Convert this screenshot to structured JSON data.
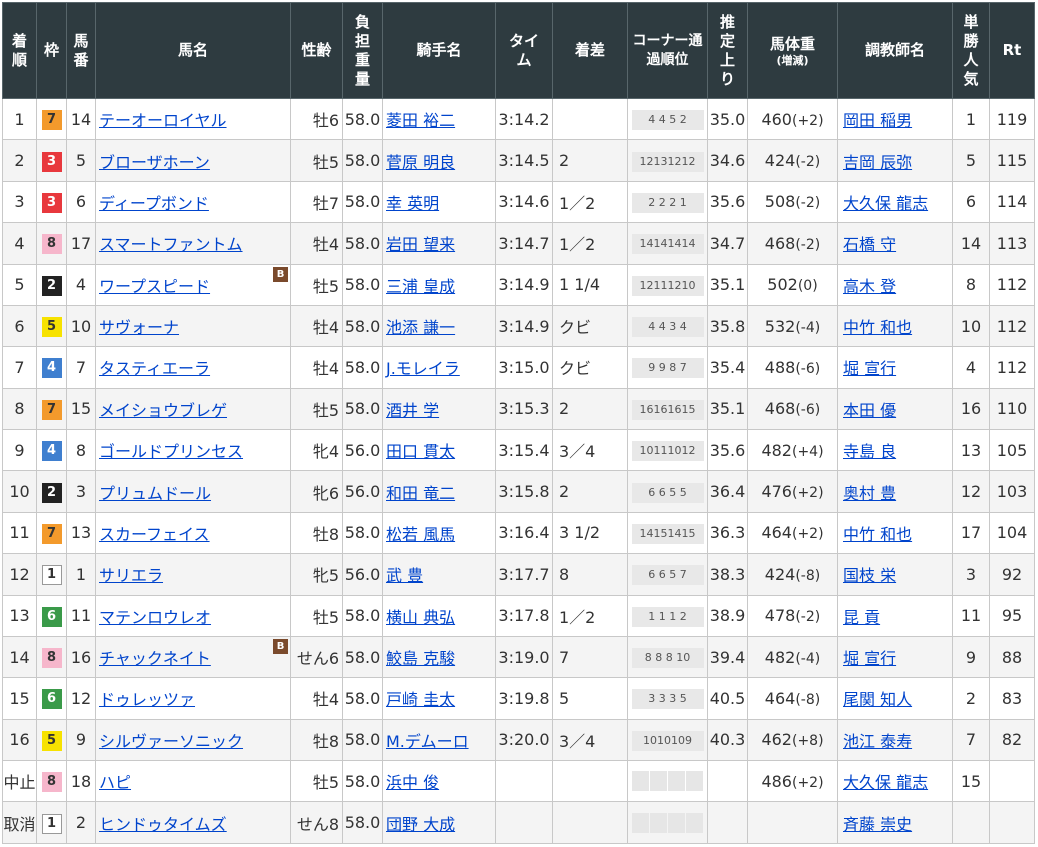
{
  "headers": {
    "rank": "着順",
    "waku": "枠",
    "umaban": "馬番",
    "horse": "馬名",
    "sex_age": "性齢",
    "weight": "負担重量",
    "jockey": "騎手名",
    "time": "タイム",
    "margin": "着差",
    "corner": "コーナー通過順位",
    "last3f": "推定上り",
    "body_weight": "馬体重",
    "body_weight_sub": "(増減)",
    "trainer": "調教師名",
    "popularity": "単勝人気",
    "rt": "Rt"
  },
  "blinker_label": "B",
  "rows": [
    {
      "rank": "1",
      "waku": "7",
      "num": "14",
      "horse": "テーオーロイヤル",
      "blinker": false,
      "sexage": "牡6",
      "wt": "58.0",
      "jockey": "菱田 裕二",
      "time": "3:14.2",
      "margin": "",
      "corner": "4 4 5 2",
      "last3f": "35.0",
      "bw": "460",
      "bwd": "(+2)",
      "trainer": "岡田 稲男",
      "pop": "1",
      "rt": "119"
    },
    {
      "rank": "2",
      "waku": "3",
      "num": "5",
      "horse": "ブローザホーン",
      "blinker": false,
      "sexage": "牡5",
      "wt": "58.0",
      "jockey": "菅原 明良",
      "time": "3:14.5",
      "margin": "2",
      "corner": "12131212",
      "last3f": "34.6",
      "bw": "424",
      "bwd": "(-2)",
      "trainer": "吉岡 辰弥",
      "pop": "5",
      "rt": "115"
    },
    {
      "rank": "3",
      "waku": "3",
      "num": "6",
      "horse": "ディープボンド",
      "blinker": false,
      "sexage": "牡7",
      "wt": "58.0",
      "jockey": "幸 英明",
      "time": "3:14.6",
      "margin": "1／2",
      "corner": "2 2 2 1",
      "last3f": "35.6",
      "bw": "508",
      "bwd": "(-2)",
      "trainer": "大久保 龍志",
      "pop": "6",
      "rt": "114"
    },
    {
      "rank": "4",
      "waku": "8",
      "num": "17",
      "horse": "スマートファントム",
      "blinker": false,
      "sexage": "牡4",
      "wt": "58.0",
      "jockey": "岩田 望来",
      "time": "3:14.7",
      "margin": "1／2",
      "corner": "14141414",
      "last3f": "34.7",
      "bw": "468",
      "bwd": "(-2)",
      "trainer": "石橋 守",
      "pop": "14",
      "rt": "113"
    },
    {
      "rank": "5",
      "waku": "2",
      "num": "4",
      "horse": "ワープスピード",
      "blinker": true,
      "sexage": "牡5",
      "wt": "58.0",
      "jockey": "三浦 皇成",
      "time": "3:14.9",
      "margin": "1 1/4",
      "corner": "12111210",
      "last3f": "35.1",
      "bw": "502",
      "bwd": "(0)",
      "trainer": "高木 登",
      "pop": "8",
      "rt": "112"
    },
    {
      "rank": "6",
      "waku": "5",
      "num": "10",
      "horse": "サヴォーナ",
      "blinker": false,
      "sexage": "牡4",
      "wt": "58.0",
      "jockey": "池添 謙一",
      "time": "3:14.9",
      "margin": "クビ",
      "corner": "4 4 3 4",
      "last3f": "35.8",
      "bw": "532",
      "bwd": "(-4)",
      "trainer": "中竹 和也",
      "pop": "10",
      "rt": "112"
    },
    {
      "rank": "7",
      "waku": "4",
      "num": "7",
      "horse": "タスティエーラ",
      "blinker": false,
      "sexage": "牡4",
      "wt": "58.0",
      "jockey": "J.モレイラ",
      "time": "3:15.0",
      "margin": "クビ",
      "corner": "9 9 8 7",
      "last3f": "35.4",
      "bw": "488",
      "bwd": "(-6)",
      "trainer": "堀 宣行",
      "pop": "4",
      "rt": "112"
    },
    {
      "rank": "8",
      "waku": "7",
      "num": "15",
      "horse": "メイショウブレゲ",
      "blinker": false,
      "sexage": "牡5",
      "wt": "58.0",
      "jockey": "酒井 学",
      "time": "3:15.3",
      "margin": "2",
      "corner": "16161615",
      "last3f": "35.1",
      "bw": "468",
      "bwd": "(-6)",
      "trainer": "本田 優",
      "pop": "16",
      "rt": "110"
    },
    {
      "rank": "9",
      "waku": "4",
      "num": "8",
      "horse": "ゴールドプリンセス",
      "blinker": false,
      "sexage": "牝4",
      "wt": "56.0",
      "jockey": "田口 貫太",
      "time": "3:15.4",
      "margin": "3／4",
      "corner": "10111012",
      "last3f": "35.6",
      "bw": "482",
      "bwd": "(+4)",
      "trainer": "寺島 良",
      "pop": "13",
      "rt": "105"
    },
    {
      "rank": "10",
      "waku": "2",
      "num": "3",
      "horse": "プリュムドール",
      "blinker": false,
      "sexage": "牝6",
      "wt": "56.0",
      "jockey": "和田 竜二",
      "time": "3:15.8",
      "margin": "2",
      "corner": "6 6 5 5",
      "last3f": "36.4",
      "bw": "476",
      "bwd": "(+2)",
      "trainer": "奥村 豊",
      "pop": "12",
      "rt": "103"
    },
    {
      "rank": "11",
      "waku": "7",
      "num": "13",
      "horse": "スカーフェイス",
      "blinker": false,
      "sexage": "牡8",
      "wt": "58.0",
      "jockey": "松若 風馬",
      "time": "3:16.4",
      "margin": "3 1/2",
      "corner": "14151415",
      "last3f": "36.3",
      "bw": "464",
      "bwd": "(+2)",
      "trainer": "中竹 和也",
      "pop": "17",
      "rt": "104"
    },
    {
      "rank": "12",
      "waku": "1",
      "num": "1",
      "horse": "サリエラ",
      "blinker": false,
      "sexage": "牝5",
      "wt": "56.0",
      "jockey": "武 豊",
      "time": "3:17.7",
      "margin": "8",
      "corner": "6 6 5 7",
      "last3f": "38.3",
      "bw": "424",
      "bwd": "(-8)",
      "trainer": "国枝 栄",
      "pop": "3",
      "rt": "92"
    },
    {
      "rank": "13",
      "waku": "6",
      "num": "11",
      "horse": "マテンロウレオ",
      "blinker": false,
      "sexage": "牡5",
      "wt": "58.0",
      "jockey": "横山 典弘",
      "time": "3:17.8",
      "margin": "1／2",
      "corner": "1 1 1 2",
      "last3f": "38.9",
      "bw": "478",
      "bwd": "(-2)",
      "trainer": "昆 貢",
      "pop": "11",
      "rt": "95"
    },
    {
      "rank": "14",
      "waku": "8",
      "num": "16",
      "horse": "チャックネイト",
      "blinker": true,
      "sexage": "せん6",
      "wt": "58.0",
      "jockey": "鮫島 克駿",
      "time": "3:19.0",
      "margin": "7",
      "corner": "8 8 8 10",
      "last3f": "39.4",
      "bw": "482",
      "bwd": "(-4)",
      "trainer": "堀 宣行",
      "pop": "9",
      "rt": "88"
    },
    {
      "rank": "15",
      "waku": "6",
      "num": "12",
      "horse": "ドゥレッツァ",
      "blinker": false,
      "sexage": "牡4",
      "wt": "58.0",
      "jockey": "戸崎 圭太",
      "time": "3:19.8",
      "margin": "5",
      "corner": "3 3 3 5",
      "last3f": "40.5",
      "bw": "464",
      "bwd": "(-8)",
      "trainer": "尾関 知人",
      "pop": "2",
      "rt": "83"
    },
    {
      "rank": "16",
      "waku": "5",
      "num": "9",
      "horse": "シルヴァーソニック",
      "blinker": false,
      "sexage": "牡8",
      "wt": "58.0",
      "jockey": "M.デムーロ",
      "time": "3:20.0",
      "margin": "3／4",
      "corner": "1010109",
      "last3f": "40.3",
      "bw": "462",
      "bwd": "(+8)",
      "trainer": "池江 泰寿",
      "pop": "7",
      "rt": "82"
    },
    {
      "rank": "中止",
      "waku": "8",
      "num": "18",
      "horse": "ハピ",
      "blinker": false,
      "sexage": "牡5",
      "wt": "58.0",
      "jockey": "浜中 俊",
      "time": "",
      "margin": "",
      "corner": "",
      "last3f": "",
      "bw": "486",
      "bwd": "(+2)",
      "trainer": "大久保 龍志",
      "pop": "15",
      "rt": ""
    },
    {
      "rank": "取消",
      "waku": "1",
      "num": "2",
      "horse": "ヒンドゥタイムズ",
      "blinker": false,
      "sexage": "せん8",
      "wt": "58.0",
      "jockey": "団野 大成",
      "time": "",
      "margin": "",
      "corner": "",
      "last3f": "",
      "bw": "",
      "bwd": "",
      "trainer": "斉藤 崇史",
      "pop": "",
      "rt": ""
    }
  ]
}
